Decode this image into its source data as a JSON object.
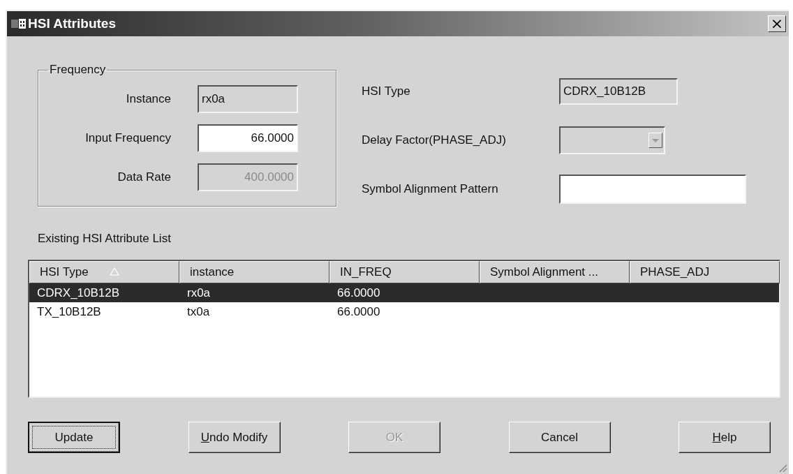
{
  "window": {
    "title": "HSI Attributes",
    "close": "×"
  },
  "frequency": {
    "title": "Frequency",
    "fields": [
      {
        "kind": "name",
        "label": "Instance",
        "value": "rx0a",
        "editable": false,
        "disabled": false
      },
      {
        "kind": "number",
        "label": "Input Frequency",
        "value": "66.0000",
        "editable": true,
        "disabled": false
      },
      {
        "kind": "number",
        "label": "Data Rate",
        "value": "400.0000",
        "editable": false,
        "disabled": true
      }
    ]
  },
  "settings": [
    {
      "kind": "readonly",
      "label": "HSI Type",
      "value": "CDRX_10B12B"
    },
    {
      "kind": "dropdown",
      "label": "Delay Factor(PHASE_ADJ)",
      "disabled": true
    },
    {
      "kind": "text",
      "label": "Symbol Alignment Pattern"
    }
  ],
  "list": {
    "title": "Existing HSI Attribute List",
    "columns": [
      {
        "label": "HSI Type",
        "sorted": true
      },
      {
        "label": "instance",
        "sorted": false
      },
      {
        "label": "IN_FREQ",
        "sorted": false
      },
      {
        "label": "Symbol Alignment ...",
        "sorted": false
      },
      {
        "label": "PHASE_ADJ",
        "sorted": false
      }
    ],
    "rows": [
      {
        "selected": true,
        "cells": [
          "CDRX_10B12B",
          "rx0a",
          "66.0000"
        ]
      },
      {
        "selected": false,
        "cells": [
          "TX_10B12B",
          "tx0a",
          "66.0000"
        ]
      }
    ]
  },
  "buttons": [
    {
      "label": "Update",
      "focused": true,
      "disabled": false,
      "underline_first": false
    },
    {
      "label": "Undo Modify",
      "focused": false,
      "disabled": false,
      "underline_first": true
    },
    {
      "label": "OK",
      "focused": false,
      "disabled": true,
      "underline_first": false
    },
    {
      "label": "Cancel",
      "focused": false,
      "disabled": false,
      "underline_first": false
    },
    {
      "label": "Help",
      "focused": false,
      "disabled": false,
      "underline_first": true
    }
  ]
}
